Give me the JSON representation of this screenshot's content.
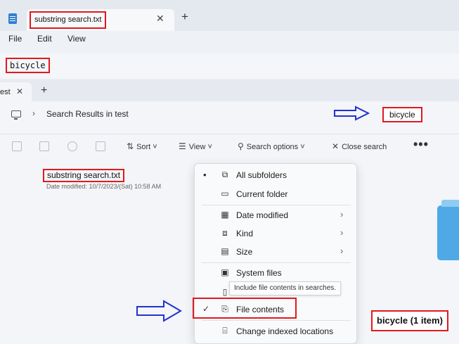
{
  "notepad": {
    "tab_title": "substring search.txt",
    "tab_close": "✕",
    "new_tab": "+",
    "menu": [
      "File",
      "Edit",
      "View"
    ],
    "text": "bicycle"
  },
  "explorer": {
    "tab_title": "est",
    "tab_close": "✕",
    "new_tab": "+",
    "breadcrumb_sep": "›",
    "path": "Search Results in test",
    "search_query": "bicycle",
    "toolbar": {
      "sort": "Sort",
      "view": "View",
      "search_options": "Search options",
      "close_search": "Close search",
      "more": "•••"
    },
    "file": {
      "name": "substring search.txt",
      "date": "Date modified: 10/7/2023/(Sat) 10:58 AM"
    },
    "menu": {
      "all_subfolders": "All subfolders",
      "current_folder": "Current folder",
      "date_modified": "Date modified",
      "kind": "Kind",
      "size": "Size",
      "system_files": "System files",
      "tooltip": "Include file contents in searches.",
      "file_contents": "File contents",
      "change_indexed": "Change indexed locations",
      "bullet": "•",
      "check": "✓",
      "submenu_arrow": "›"
    },
    "result_count": "bicycle (1 item)"
  },
  "colors": {
    "highlight_border": "#e0191f",
    "arrow_blue": "#2233cc",
    "folder_blue": "#4fa9e6"
  },
  "icons": [
    "notepad-icon",
    "computer-icon",
    "copy-icon",
    "paste-icon",
    "share-icon",
    "delete-icon",
    "sort-icon",
    "view-icon",
    "search-options-icon",
    "close-icon",
    "folder-tree-icon",
    "folder-icon",
    "calendar-icon",
    "kind-icon",
    "size-icon",
    "system-file-icon",
    "file-contents-icon",
    "indexed-locations-icon"
  ]
}
